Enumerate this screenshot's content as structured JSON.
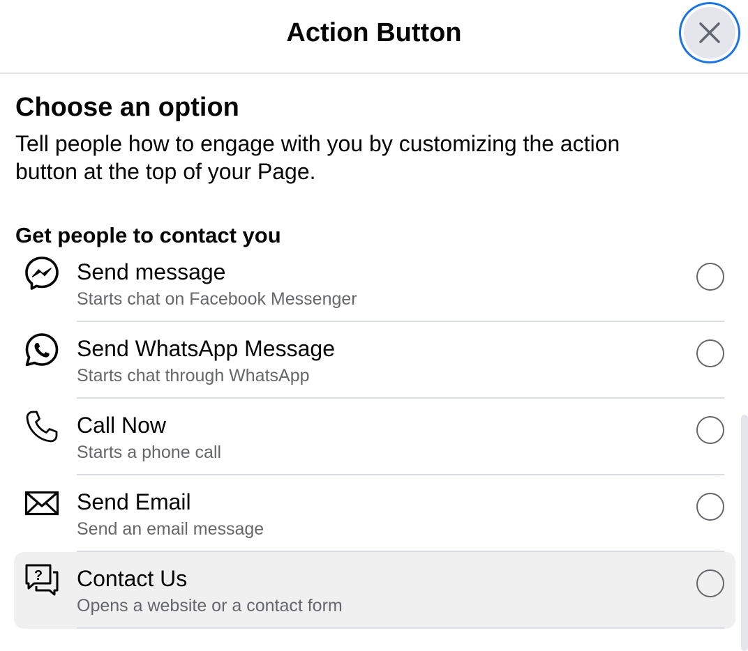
{
  "header": {
    "title": "Action Button",
    "close_icon": "close-icon"
  },
  "intro": {
    "title": "Choose an option",
    "description": "Tell people how to engage with you by customizing the action button at the top of your Page."
  },
  "group": {
    "title": "Get people to contact you"
  },
  "options": [
    {
      "icon": "messenger-icon",
      "label": "Send message",
      "sublabel": "Starts chat on Facebook Messenger",
      "selected": false
    },
    {
      "icon": "whatsapp-icon",
      "label": "Send WhatsApp Message",
      "sublabel": "Starts chat through WhatsApp",
      "selected": false
    },
    {
      "icon": "phone-icon",
      "label": "Call Now",
      "sublabel": "Starts a phone call",
      "selected": false
    },
    {
      "icon": "envelope-icon",
      "label": "Send Email",
      "sublabel": "Send an email message",
      "selected": false
    },
    {
      "icon": "question-chat-icon",
      "label": "Contact Us",
      "sublabel": "Opens a website or a contact form",
      "selected": false,
      "hovered": true
    }
  ],
  "colors": {
    "accent": "#1b74e4",
    "secondary_text": "#65676b",
    "hover_bg": "#f0f0f0"
  }
}
